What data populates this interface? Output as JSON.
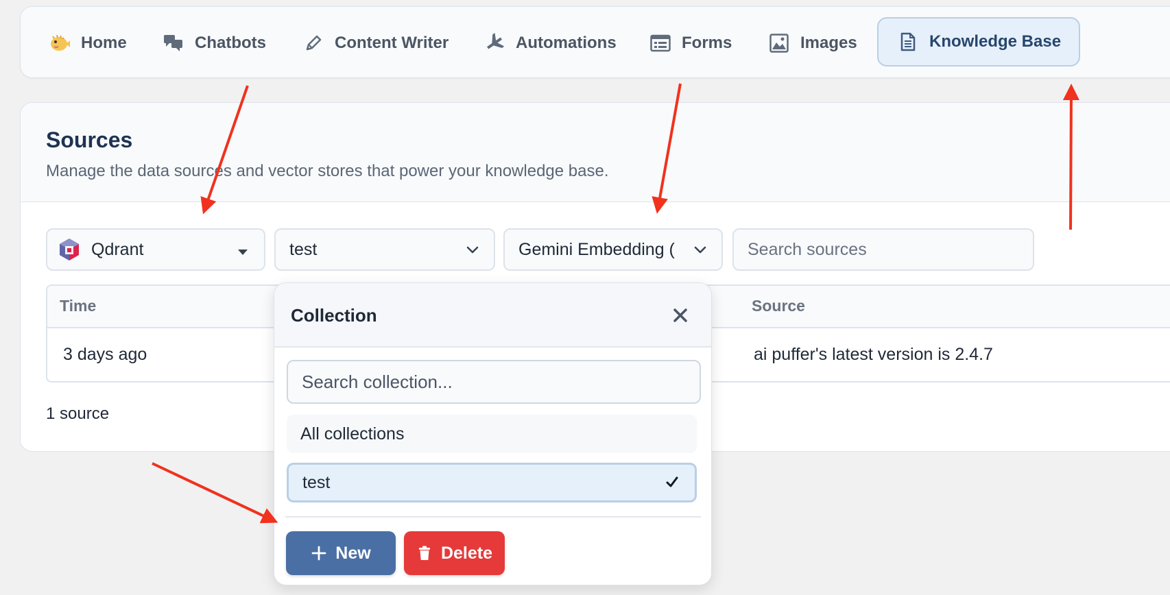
{
  "nav": {
    "items": [
      {
        "label": "Home",
        "icon": "pufferfish-icon"
      },
      {
        "label": "Chatbots",
        "icon": "chat-bubbles-icon"
      },
      {
        "label": "Content Writer",
        "icon": "pencil-icon"
      },
      {
        "label": "Automations",
        "icon": "airplane-icon"
      },
      {
        "label": "Forms",
        "icon": "form-icon"
      },
      {
        "label": "Images",
        "icon": "image-icon"
      },
      {
        "label": "Knowledge Base",
        "icon": "document-icon",
        "active": true
      }
    ]
  },
  "sources": {
    "title": "Sources",
    "subtitle": "Manage the data sources and vector stores that power your knowledge base.",
    "provider_select": {
      "value": "Qdrant",
      "icon": "qdrant-logo-icon"
    },
    "collection_select": {
      "value": "test"
    },
    "embedding_select": {
      "value": "Gemini Embedding ("
    },
    "search": {
      "placeholder": "Search sources"
    },
    "table": {
      "columns": [
        "Time",
        "Source"
      ],
      "rows": [
        {
          "time": "3 days ago",
          "source": "ai puffer's latest version is 2.4.7"
        }
      ]
    },
    "count_label": "1 source"
  },
  "collection_popover": {
    "title": "Collection",
    "search_placeholder": "Search collection...",
    "options": [
      {
        "label": "All collections",
        "selected": false
      },
      {
        "label": "test",
        "selected": true
      }
    ],
    "new_label": "New",
    "delete_label": "Delete"
  },
  "colors": {
    "accent": "#4a6fa5",
    "danger": "#e63a3a",
    "annotation_arrow": "#f0321e",
    "active_tab_bg": "#e6f0fb"
  }
}
